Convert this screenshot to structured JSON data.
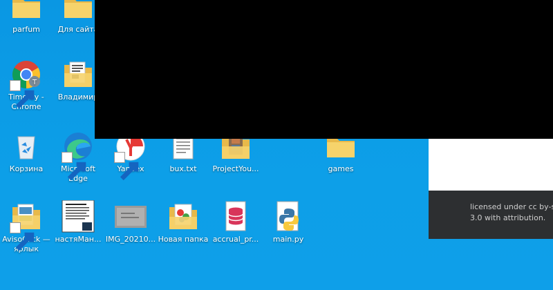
{
  "desktop": {
    "icons": [
      {
        "label": "parfum",
        "icon": "folder-icon"
      },
      {
        "label": "Для сайта",
        "icon": "folder-icon"
      },
      {
        "label": "Timofey - Chrome",
        "icon": "chrome-icon"
      },
      {
        "label": "Владимир",
        "icon": "folder-documents-icon"
      },
      {
        "label": "Корзина",
        "icon": "recycle-bin-icon"
      },
      {
        "label": "Microsoft Edge",
        "icon": "edge-icon"
      },
      {
        "label": "Yandex",
        "icon": "yandex-browser-icon"
      },
      {
        "label": "bux.txt",
        "icon": "text-file-icon"
      },
      {
        "label": "ProjectYou...",
        "icon": "folder-photos-icon"
      },
      {
        "label": "games",
        "icon": "folder-icon"
      },
      {
        "label": "AvisoClick — ярлык",
        "icon": "folder-shortcut-icon"
      },
      {
        "label": "настяМан...",
        "icon": "document-thumbnail-icon"
      },
      {
        "label": "IMG_20210...",
        "icon": "image-thumbnail-icon"
      },
      {
        "label": "Новая папка",
        "icon": "folder-photos-icon"
      },
      {
        "label": "accrual_pr...",
        "icon": "database-file-icon"
      },
      {
        "label": "main.py",
        "icon": "python-file-icon"
      }
    ]
  },
  "dialog": {
    "text_line1": "licensed under cc by-s",
    "text_line2": "3.0 with attribution."
  }
}
